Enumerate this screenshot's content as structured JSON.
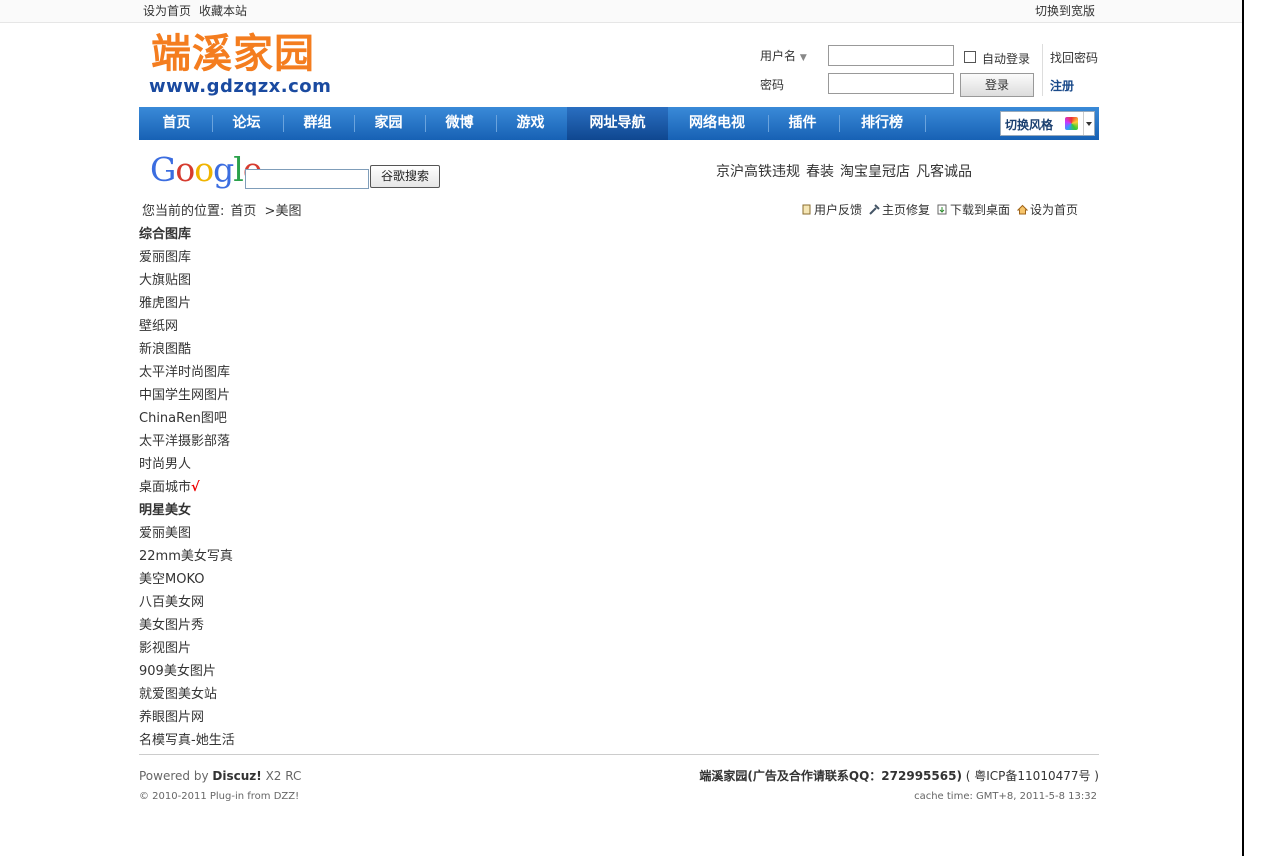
{
  "topbar": {
    "set_home": "设为首页",
    "bookmark": "收藏本站",
    "switch_wide": "切换到宽版"
  },
  "logo": {
    "cn": "端溪家园",
    "url": "www.gdzqzx.com"
  },
  "login": {
    "username_label": "用户名",
    "password_label": "密码",
    "auto_login": "自动登录",
    "login_button": "登录",
    "forgot_password": "找回密码",
    "register": "注册"
  },
  "nav": {
    "items": [
      "首页",
      "论坛",
      "群组",
      "家园",
      "微博",
      "游戏",
      "网址导航",
      "网络电视",
      "插件",
      "排行榜"
    ],
    "active": "网址导航",
    "style_switch": "切换风格"
  },
  "search": {
    "google_logo": "Google",
    "button": "谷歌搜索",
    "hot_links": [
      "京沪高铁违规",
      "春装",
      "淘宝皇冠店",
      "凡客诚品"
    ]
  },
  "breadcrumb": {
    "prefix": "您当前的位置:",
    "home": "首页",
    "current": ">美图"
  },
  "tools": [
    "用户反馈",
    "主页修复",
    "下载到桌面",
    "设为首页"
  ],
  "sections": [
    {
      "title": "综合图库",
      "links": [
        "爱丽图库",
        "大旗贴图",
        "雅虎图片",
        "壁纸网",
        "新浪图酷",
        "太平洋时尚图库",
        "中国学生网图片",
        "ChinaRen图吧",
        "太平洋摄影部落",
        "时尚男人",
        "桌面城市"
      ]
    },
    {
      "title": "明星美女",
      "links": [
        "爱丽美图",
        "22mm美女写真",
        "美空MOKO",
        "八百美女网",
        "美女图片秀",
        "影视图片",
        "909美女图片",
        "就爱图美女站",
        "养眼图片网",
        "名模写真-她生活"
      ]
    }
  ],
  "checkmark": "√",
  "footer": {
    "powered": "Powered by",
    "discuz": "Discuz!",
    "version": "X2 RC",
    "copyright": "© 2010-2011 Plug-in from DZZ!",
    "site_contact": "端溪家园(广告及合作请联系QQ：272995565)",
    "icp": "( 粤ICP备11010477号 )",
    "cache": "cache time: GMT+8, 2011-5-8 13:32"
  }
}
